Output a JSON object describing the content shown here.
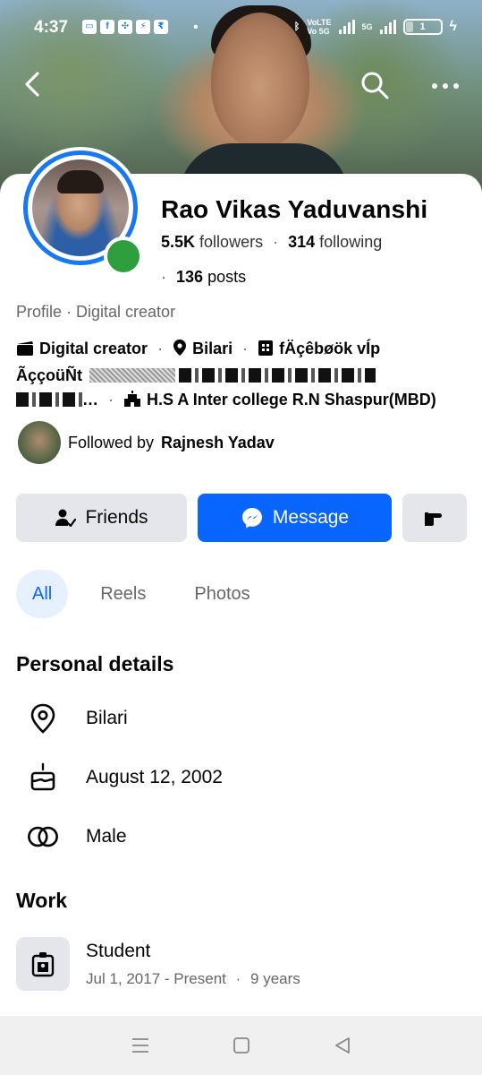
{
  "status_bar": {
    "time": "4:37",
    "network_top": "VoLTE",
    "network_bottom": "Vo 5G",
    "network_badge": "5G",
    "battery": "1"
  },
  "profile": {
    "name": "Rao Vikas Yaduvanshi",
    "followers_count": "5.5K",
    "followers_label": "followers",
    "following_count": "314",
    "following_label": "following",
    "posts_count": "136",
    "posts_label": "posts",
    "category": "Profile · Digital creator"
  },
  "intro": {
    "creator": "Digital creator",
    "location": "Bilari",
    "account_line1": "fÄçêbøök vÍp",
    "account_line2": "ÃççoüÑt",
    "ellipsis": "…",
    "school": "H.S A Inter college R.N Shaspur(MBD)"
  },
  "followed_by": {
    "prefix": "Followed by",
    "name": "Rajnesh Yadav"
  },
  "buttons": {
    "friends": "Friends",
    "message": "Message"
  },
  "tabs": [
    "All",
    "Reels",
    "Photos"
  ],
  "personal_details": {
    "heading": "Personal details",
    "items": [
      {
        "icon": "location-pin-icon",
        "text": "Bilari"
      },
      {
        "icon": "birthday-cake-icon",
        "text": "August 12, 2002"
      },
      {
        "icon": "gender-rings-icon",
        "text": "Male"
      }
    ]
  },
  "work": {
    "heading": "Work",
    "title": "Student",
    "dates": "Jul 1, 2017 - Present",
    "duration": "9 years"
  },
  "colors": {
    "primary": "#0866ff",
    "ring": "#1877f2",
    "online": "#2e9e3e",
    "button_gray": "#e4e6eb",
    "muted": "#65676b"
  }
}
